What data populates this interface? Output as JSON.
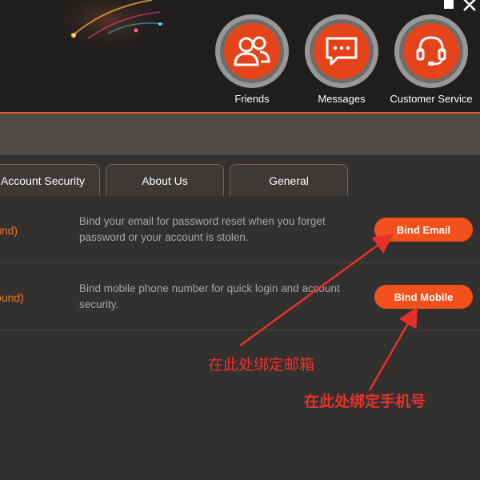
{
  "window": {
    "controls": [
      "maximize-icon",
      "close-icon"
    ]
  },
  "header": {
    "nav": [
      {
        "label": "Friends",
        "icon": "friends-icon"
      },
      {
        "label": "Messages",
        "icon": "message-icon"
      },
      {
        "label": "Customer Service",
        "icon": "headset-icon"
      }
    ],
    "accent": "#e5441b"
  },
  "tabs": [
    {
      "label": "Account Security"
    },
    {
      "label": "About Us"
    },
    {
      "label": "General"
    }
  ],
  "rows": [
    {
      "status": "und)",
      "description": "Bind your email for password reset when you forget password or your account is stolen.",
      "button": "Bind Email"
    },
    {
      "status": "ound)",
      "description": "Bind mobile phone number for quick login and account security.",
      "button": "Bind Mobile"
    }
  ],
  "annotations": {
    "email": "在此处绑定邮箱",
    "mobile": "在此处绑定手机号",
    "color": "#e8302a"
  }
}
